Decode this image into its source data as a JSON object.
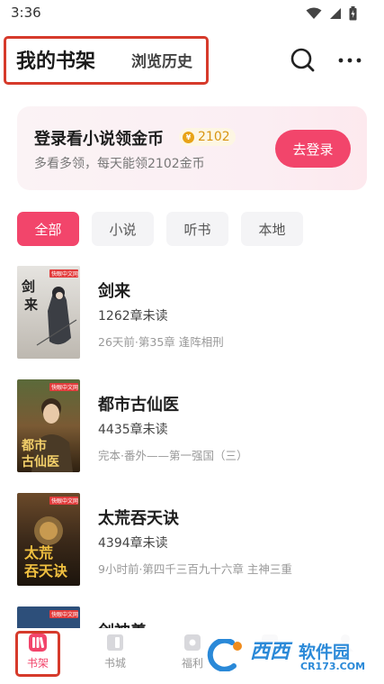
{
  "status_bar": {
    "time": "3:36"
  },
  "header": {
    "tab_bookshelf": "我的书架",
    "tab_history": "浏览历史",
    "search_icon": "search-icon",
    "more_icon": "more-icon"
  },
  "login_card": {
    "title": "登录看小说领金币",
    "coin_amount": "2102",
    "subtitle": "多看多领，每天能领2102金币",
    "button": "去登录"
  },
  "filters": [
    {
      "label": "全部",
      "active": true
    },
    {
      "label": "小说",
      "active": false
    },
    {
      "label": "听书",
      "active": false
    },
    {
      "label": "本地",
      "active": false
    }
  ],
  "books": [
    {
      "title": "剑来",
      "unread": "1262章未读",
      "status": "26天前·第35章 逢阵相刑",
      "cover_text": "剑来",
      "cover_color": "#dcdad6"
    },
    {
      "title": "都市古仙医",
      "unread": "4435章未读",
      "status": "完本·番外——第一强国（三）",
      "cover_text": "都市古仙医",
      "cover_color": "#7a5a34"
    },
    {
      "title": "太荒吞天诀",
      "unread": "4394章未读",
      "status": "9小时前·第四千三百九十六章 主神三重",
      "cover_text": "太荒吞天诀",
      "cover_color": "#3c2a1a"
    },
    {
      "title": "剑神義",
      "unread": "",
      "status": "",
      "cover_text": "",
      "cover_color": "#2d4f7a"
    }
  ],
  "cover_badge": "快眼中文网",
  "bottom_nav": [
    {
      "label": "书架",
      "icon": "bookshelf-icon",
      "active": true
    },
    {
      "label": "书城",
      "icon": "bookstore-icon",
      "active": false
    },
    {
      "label": "福利",
      "icon": "welfare-icon",
      "active": false
    },
    {
      "label": "",
      "icon": "video-icon",
      "active": false
    },
    {
      "label": "",
      "icon": "profile-icon",
      "active": false
    }
  ],
  "watermark": {
    "main": "西西",
    "soft": "软件园",
    "url": "CR173.COM"
  },
  "colors": {
    "accent": "#f2456b",
    "coin": "#e8a316",
    "highlight_box": "#d63a2b",
    "watermark": "#2a89d8"
  }
}
